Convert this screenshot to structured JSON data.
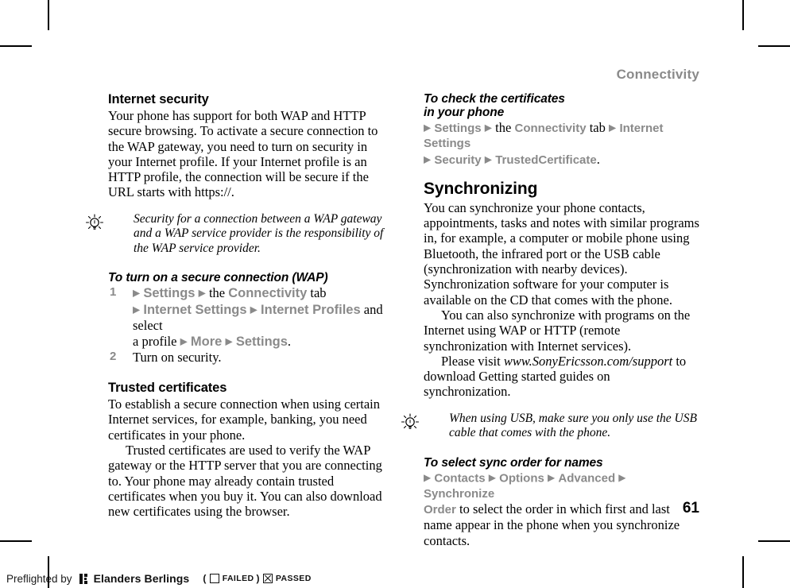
{
  "running_head": "Connectivity",
  "page_number": "61",
  "arrow_glyph": "▶",
  "colors": {
    "menu_gray": "#8a8a8a",
    "text_black": "#000000",
    "running_head_gray": "#8a8a8a"
  },
  "left_column": {
    "section1": {
      "heading": "Internet security",
      "body": "Your phone has support for both WAP and HTTP secure browsing. To activate a secure connection to the WAP gateway, you need to turn on security in your Internet profile. If your Internet profile is an HTTP profile, the connection will be secure if the URL starts with https://."
    },
    "tip1": {
      "icon": "lightbulb-tip-icon",
      "text": "Security for a connection between a WAP gateway and a WAP service provider is the responsibility of the WAP service provider."
    },
    "procedure1": {
      "heading": "To turn on a secure connection (WAP)",
      "steps": [
        {
          "number": "1",
          "parts": [
            {
              "type": "arrow"
            },
            {
              "type": "menu",
              "text": "Settings"
            },
            {
              "type": "arrow"
            },
            {
              "type": "plain",
              "text": "the"
            },
            {
              "type": "menu",
              "text": "Connectivity"
            },
            {
              "type": "plain",
              "text": "tab"
            },
            {
              "type": "break"
            },
            {
              "type": "arrow"
            },
            {
              "type": "menu",
              "text": "Internet Settings"
            },
            {
              "type": "arrow"
            },
            {
              "type": "menu",
              "text": "Internet Profiles"
            },
            {
              "type": "plain",
              "text": "and select"
            },
            {
              "type": "break"
            },
            {
              "type": "plain",
              "text": "a profile"
            },
            {
              "type": "arrow"
            },
            {
              "type": "menu",
              "text": "More"
            },
            {
              "type": "arrow"
            },
            {
              "type": "menu",
              "text": "Settings"
            },
            {
              "type": "plain",
              "text": "."
            }
          ]
        },
        {
          "number": "2",
          "parts": [
            {
              "type": "plain",
              "text": "Turn on security."
            }
          ]
        }
      ]
    },
    "section2": {
      "heading": "Trusted certificates",
      "body1": "To establish a secure connection when using certain Internet services, for example, banking, you need certificates in your phone.",
      "body2": "Trusted certificates are used to verify the WAP gateway or the HTTP server that you are connecting to. Your phone may already contain trusted certificates when you buy it. You can also download new certificates using the browser."
    }
  },
  "right_column": {
    "procedure1": {
      "heading_line1": "To check the certificates",
      "heading_line2": "in your phone",
      "path": [
        {
          "type": "arrow"
        },
        {
          "type": "menu",
          "text": "Settings"
        },
        {
          "type": "arrow"
        },
        {
          "type": "plain",
          "text": "the"
        },
        {
          "type": "menu",
          "text": "Connectivity"
        },
        {
          "type": "plain",
          "text": "tab"
        },
        {
          "type": "arrow"
        },
        {
          "type": "menu",
          "text": "Internet Settings"
        },
        {
          "type": "break"
        },
        {
          "type": "arrow"
        },
        {
          "type": "menu",
          "text": "Security"
        },
        {
          "type": "arrow"
        },
        {
          "type": "menu",
          "text": "TrustedCertificate"
        },
        {
          "type": "plain",
          "text": "."
        }
      ]
    },
    "section1": {
      "heading": "Synchronizing",
      "body1": "You can synchronize your phone contacts, appointments, tasks and notes with similar programs in, for example, a computer or mobile phone using Bluetooth, the infrared port or the USB cable (synchronization with nearby devices). Synchronization software for your computer is available on the CD that comes with the phone.",
      "body2": "You can also synchronize with programs on the Internet using WAP or HTTP (remote synchronization with Internet services).",
      "body3_before": "Please visit ",
      "body3_url": "www.SonyEricsson.com/support",
      "body3_after": " to download Getting started guides on synchronization."
    },
    "tip1": {
      "icon": "lightbulb-tip-icon",
      "text": "When using USB, make sure you only use the USB cable that comes with the phone."
    },
    "procedure2": {
      "heading": "To select sync order for names",
      "path": [
        {
          "type": "arrow"
        },
        {
          "type": "menu",
          "text": "Contacts"
        },
        {
          "type": "arrow"
        },
        {
          "type": "menu",
          "text": "Options"
        },
        {
          "type": "arrow"
        },
        {
          "type": "menu",
          "text": "Advanced"
        },
        {
          "type": "arrow"
        },
        {
          "type": "menu",
          "text": "Synchronize"
        },
        {
          "type": "break"
        },
        {
          "type": "menu",
          "text": "Order"
        },
        {
          "type": "plain",
          "text": "to select the order in which first and last name appear in the phone when you synchronize contacts."
        }
      ]
    }
  },
  "preflight": {
    "label": "Preflighted by",
    "logo": "elanders-logo-icon",
    "brand": "Elanders Berlings",
    "paren_open": "(",
    "failed_label": "FAILED",
    "paren_close": ")",
    "passed_label": "PASSED",
    "failed_checked": false,
    "passed_checked": true
  }
}
